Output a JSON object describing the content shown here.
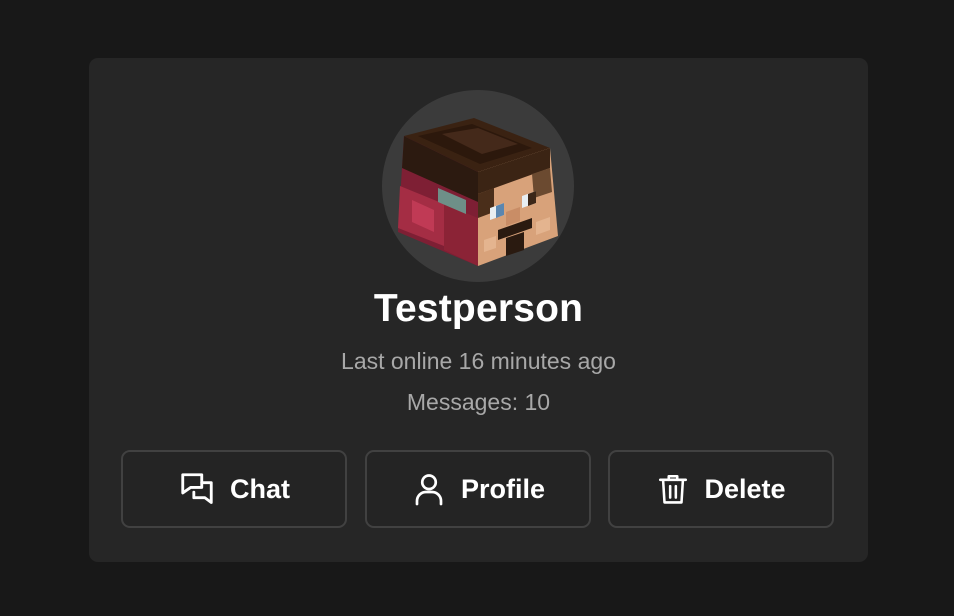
{
  "profile": {
    "username": "Testperson",
    "last_online": "Last online 16 minutes ago",
    "messages_label": "Messages: ",
    "messages_count": "10",
    "avatar_icon": "minecraft-head-avatar"
  },
  "actions": {
    "chat_label": "Chat",
    "chat_icon": "chat-bubbles-icon",
    "profile_label": "Profile",
    "profile_icon": "user-icon",
    "delete_label": "Delete",
    "delete_icon": "trash-icon"
  },
  "colors": {
    "page_background": "#181818",
    "card_background": "#262626",
    "avatar_background": "#3b3b3b",
    "button_border": "#414141",
    "primary_text": "#ffffff",
    "secondary_text": "#a8a8a8"
  }
}
